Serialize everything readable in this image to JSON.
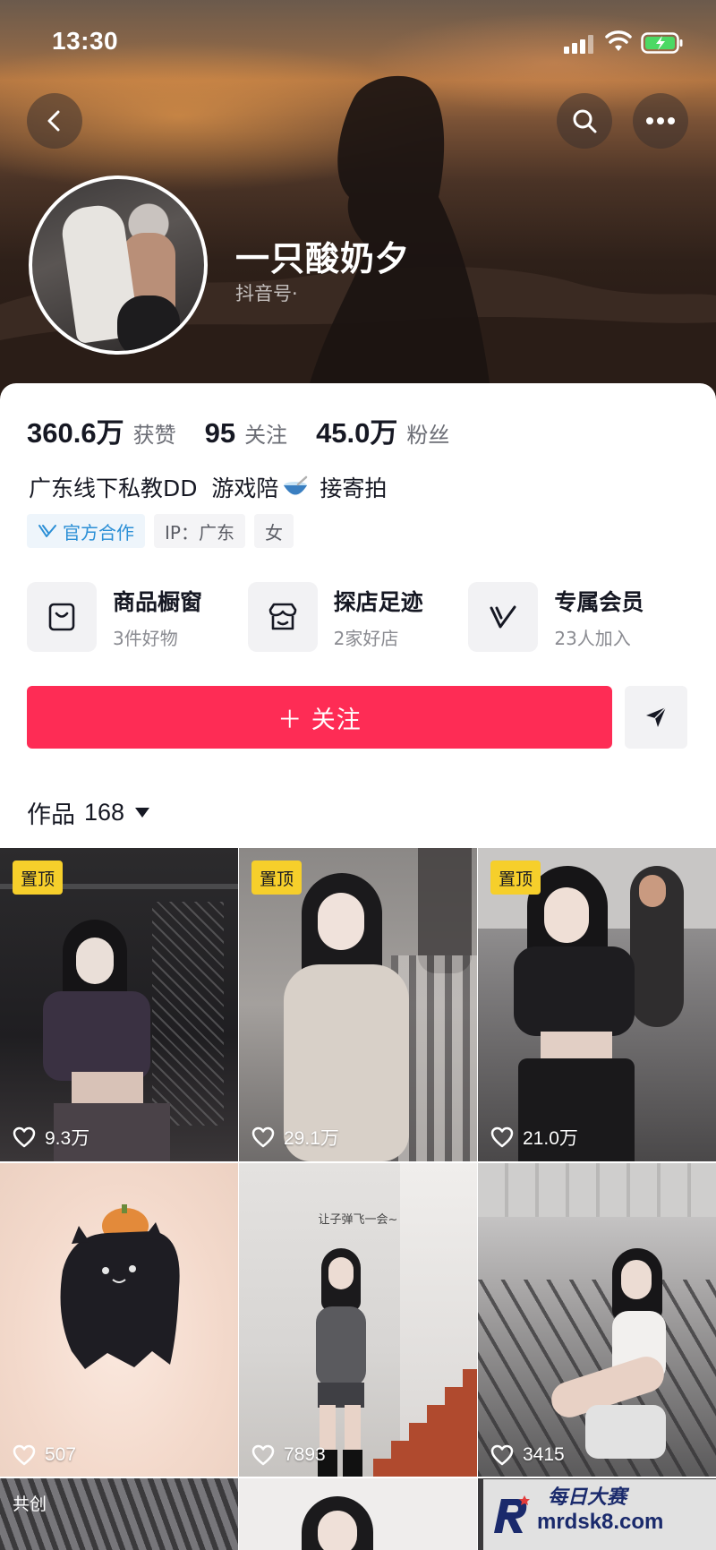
{
  "status_bar": {
    "time": "13:30"
  },
  "profile": {
    "nickname": "一只酸奶夕",
    "douyin_id_label": "抖音号·",
    "bio_before": "广东线下私教DD  游戏陪",
    "bio_after": " 接寄拍",
    "tags": [
      "官方合作",
      "IP：广东",
      "女"
    ]
  },
  "stats": [
    {
      "value": "360.6万",
      "label": "获赞"
    },
    {
      "value": "95",
      "label": "关注"
    },
    {
      "value": "45.0万",
      "label": "粉丝"
    }
  ],
  "services": [
    {
      "title": "商品橱窗",
      "sub": "3件好物",
      "icon": "bag-icon"
    },
    {
      "title": "探店足迹",
      "sub": "2家好店",
      "icon": "shop-icon"
    },
    {
      "title": "专属会员",
      "sub": "23人加入",
      "icon": "v-member-icon"
    }
  ],
  "actions": {
    "follow_label": "＋ 关注"
  },
  "works": {
    "label": "作品",
    "count": "168",
    "pin_label": "置顶",
    "coop_label": "共创",
    "items": [
      {
        "likes": "9.3万",
        "pinned": true
      },
      {
        "likes": "29.1万",
        "pinned": true
      },
      {
        "likes": "21.0万",
        "pinned": true
      },
      {
        "likes": "507",
        "pinned": false
      },
      {
        "likes": "7893",
        "pinned": false
      },
      {
        "likes": "3415",
        "pinned": false
      }
    ],
    "overlay_text": "让子弹飞一会~"
  },
  "watermark": {
    "line1": "每日大赛",
    "line2": "mrdsk8.com"
  },
  "colors": {
    "accent": "#fe2c55",
    "pin": "#f6cf2b",
    "official": "#2b8fd6"
  }
}
